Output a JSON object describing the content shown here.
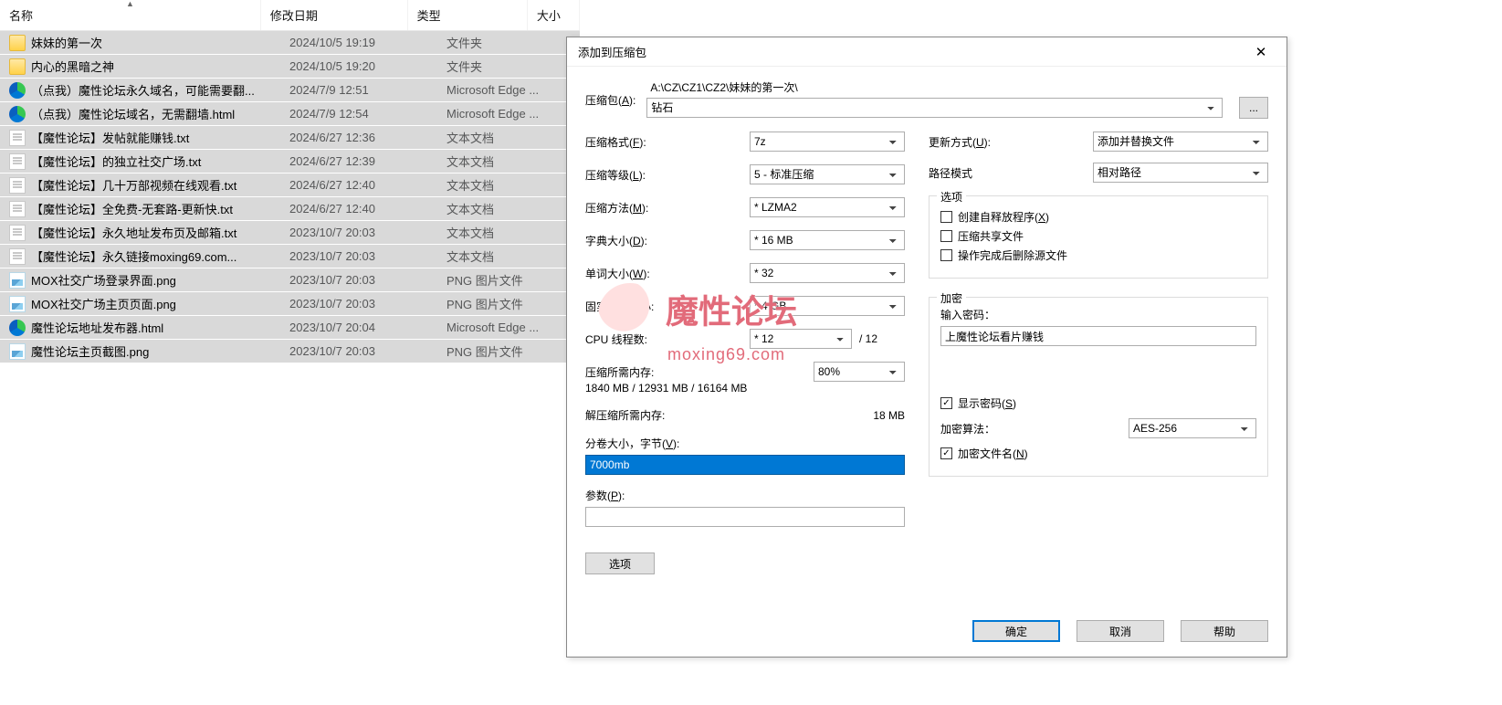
{
  "list": {
    "headers": {
      "name": "名称",
      "date": "修改日期",
      "type": "类型",
      "size": "大小"
    },
    "rows": [
      {
        "icon": "folder",
        "name": "妹妹的第一次",
        "date": "2024/10/5 19:19",
        "type": "文件夹"
      },
      {
        "icon": "folder",
        "name": "内心的黑暗之神",
        "date": "2024/10/5 19:20",
        "type": "文件夹"
      },
      {
        "icon": "edge",
        "name": "（点我）魔性论坛永久域名，可能需要翻...",
        "date": "2024/7/9 12:51",
        "type": "Microsoft Edge ..."
      },
      {
        "icon": "edge",
        "name": "（点我）魔性论坛域名，无需翻墙.html",
        "date": "2024/7/9 12:54",
        "type": "Microsoft Edge ..."
      },
      {
        "icon": "txt",
        "name": "【魔性论坛】发帖就能赚钱.txt",
        "date": "2024/6/27 12:36",
        "type": "文本文档"
      },
      {
        "icon": "txt",
        "name": "【魔性论坛】的独立社交广场.txt",
        "date": "2024/6/27 12:39",
        "type": "文本文档"
      },
      {
        "icon": "txt",
        "name": "【魔性论坛】几十万部视频在线观看.txt",
        "date": "2024/6/27 12:40",
        "type": "文本文档"
      },
      {
        "icon": "txt",
        "name": "【魔性论坛】全免费-无套路-更新快.txt",
        "date": "2024/6/27 12:40",
        "type": "文本文档"
      },
      {
        "icon": "txt",
        "name": "【魔性论坛】永久地址发布页及邮箱.txt",
        "date": "2023/10/7 20:03",
        "type": "文本文档"
      },
      {
        "icon": "txt",
        "name": "【魔性论坛】永久链接moxing69.com...",
        "date": "2023/10/7 20:03",
        "type": "文本文档"
      },
      {
        "icon": "png",
        "name": "MOX社交广场登录界面.png",
        "date": "2023/10/7 20:03",
        "type": "PNG 图片文件"
      },
      {
        "icon": "png",
        "name": "MOX社交广场主页页面.png",
        "date": "2023/10/7 20:03",
        "type": "PNG 图片文件"
      },
      {
        "icon": "edge",
        "name": "魔性论坛地址发布器.html",
        "date": "2023/10/7 20:04",
        "type": "Microsoft Edge ..."
      },
      {
        "icon": "png",
        "name": "魔性论坛主页截图.png",
        "date": "2023/10/7 20:03",
        "type": "PNG 图片文件"
      }
    ]
  },
  "dialog": {
    "title": "添加到压缩包",
    "archive_label": "压缩包(",
    "archive_u": "A",
    "archive_label2": "):",
    "archive_path": "A:\\CZ\\CZ1\\CZ2\\妹妹的第一次\\",
    "archive_name": "钻石",
    "browse": "...",
    "format_label": "压缩格式(",
    "format_u": "F",
    "level_label": "压缩等级(",
    "level_u": "L",
    "method_label": "压缩方法(",
    "method_u": "M",
    "dict_label": "字典大小(",
    "dict_u": "D",
    "word_label": "单词大小(",
    "word_u": "W",
    "solid_label": "固实数据大小:",
    "threads_label": "CPU 线程数:",
    "threads_total": "/ 12",
    "mem_c_label": "压缩所需内存:",
    "mem_c_value": "1840 MB / 12931 MB / 16164 MB",
    "mem_c_pct": "80%",
    "mem_d_label": "解压缩所需内存:",
    "mem_d_value": "18 MB",
    "split_label": "分卷大小，字节(",
    "split_u": "V",
    "split_value": "7000mb",
    "param_label": "参数(",
    "param_u": "P",
    "param_value": "",
    "opt_btn": "选项",
    "update_label": "更新方式(",
    "update_u": "U",
    "path_label": "路径模式",
    "options_legend": "选项",
    "chk_sfx": "创建自释放程序(",
    "chk_sfx_u": "X",
    "chk_shared": "压缩共享文件",
    "chk_delete": "操作完成后删除源文件",
    "enc_legend": "加密",
    "enc_pwd_label": "输入密码：",
    "enc_pwd_value": "上魔性论坛看片赚钱",
    "chk_showpwd": "显示密码(",
    "chk_showpwd_u": "S",
    "enc_method_label": "加密算法：",
    "chk_encnames": "加密文件名(",
    "chk_encnames_u": "N",
    "ok": "确定",
    "cancel": "取消",
    "help": "帮助"
  },
  "selects": {
    "format": "7z",
    "level": "5 - 标准压缩",
    "method": "* LZMA2",
    "dict": "* 16 MB",
    "word": "* 32",
    "solid": "* 4 GB",
    "threads": "* 12",
    "update": "添加并替换文件",
    "pathmode": "相对路径",
    "encmethod": "AES-256"
  },
  "watermark": {
    "text": "魔性论坛",
    "sub": "moxing69.com"
  }
}
